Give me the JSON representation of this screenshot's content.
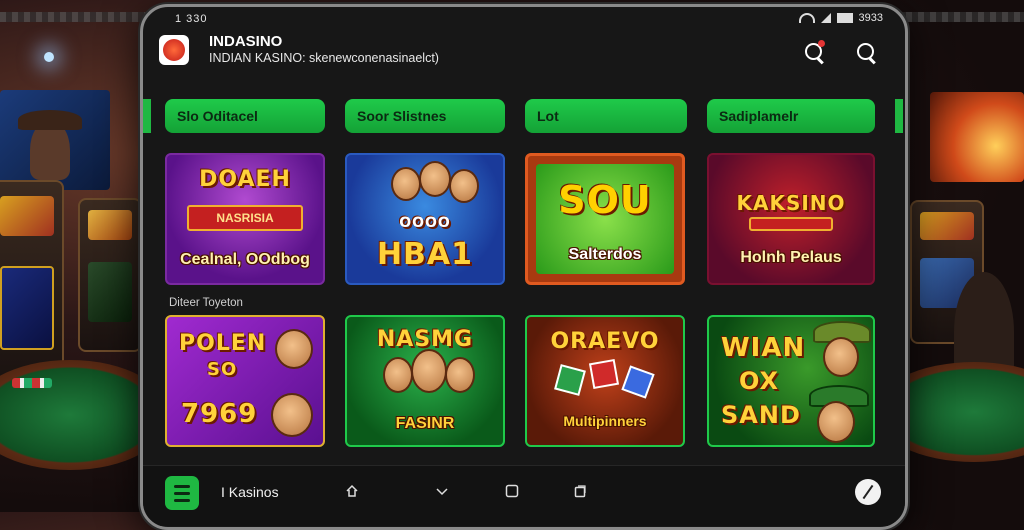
{
  "status_bar": {
    "time": "1 330",
    "right_text": "3933"
  },
  "app": {
    "title": "INDASINO",
    "subtitle": "INDIAN KASINO: skenewconenasinaelct)"
  },
  "categories": [
    {
      "label": "Slo Oditacel"
    },
    {
      "label": "Soor Slistnes"
    },
    {
      "label": "Lot"
    },
    {
      "label": "Sadiplamelr"
    }
  ],
  "section_label": "Diteer Toyeton",
  "games_row1": [
    {
      "title": "DOAEH",
      "ribbon": "NASRISIA",
      "caption": "Cealnal, OOdbog"
    },
    {
      "title": "HBA1",
      "ribbon": "OOOO",
      "caption": ""
    },
    {
      "title": "SOU",
      "ribbon": "",
      "caption": "Salterdos"
    },
    {
      "title": "KAKSINO",
      "ribbon": "",
      "caption": "Holnh Pelaus"
    }
  ],
  "games_row2": [
    {
      "title": "POLEN",
      "line2": "SO",
      "line3": "7969"
    },
    {
      "title": "NASMG",
      "caption": "FASINR"
    },
    {
      "title": "ORAEVO",
      "caption": "Multipinners"
    },
    {
      "title": "WIAN",
      "line2": "OX",
      "line3": "SAND"
    }
  ],
  "bottom_nav": {
    "label": "I Kasinos"
  },
  "colors": {
    "accent_green": "#1fca4a",
    "phone_bg": "#171717",
    "text_white": "#ffffff"
  }
}
